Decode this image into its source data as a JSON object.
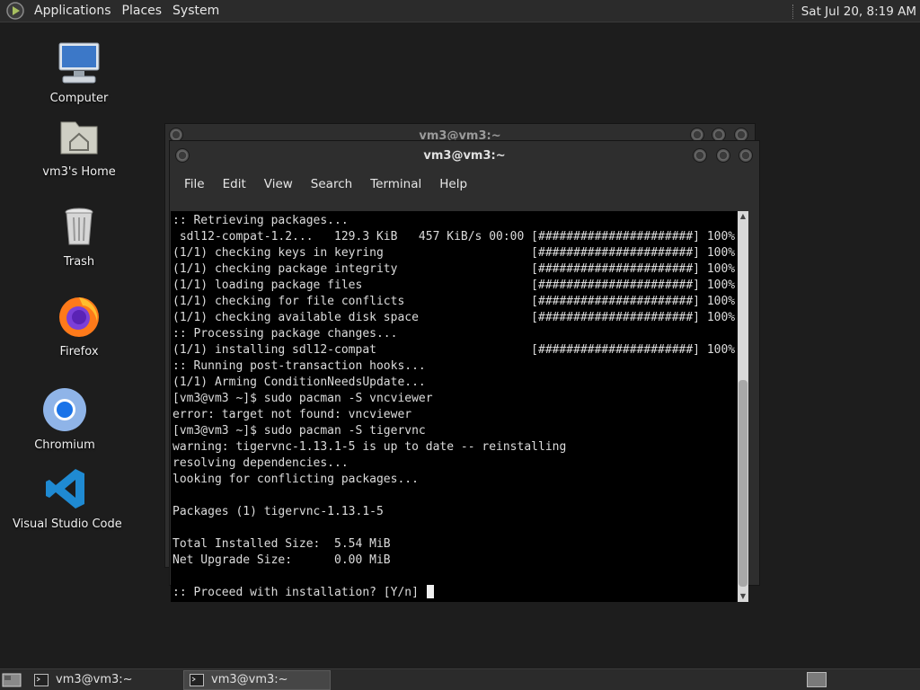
{
  "top_panel": {
    "menus": [
      "Applications",
      "Places",
      "System"
    ],
    "clock": "Sat Jul 20,  8:19 AM"
  },
  "desktop_icons": [
    {
      "label": "Computer",
      "icon": "computer-icon"
    },
    {
      "label": "vm3's Home",
      "icon": "home-folder-icon"
    },
    {
      "label": "Trash",
      "icon": "trash-icon"
    },
    {
      "label": "Firefox",
      "icon": "firefox-icon"
    },
    {
      "label": "Chromium",
      "icon": "chromium-icon"
    },
    {
      "label": "Visual Studio Code",
      "icon": "vscode-icon"
    }
  ],
  "back_window": {
    "title": "vm3@vm3:~"
  },
  "terminal": {
    "title": "vm3@vm3:~",
    "menus": [
      "File",
      "Edit",
      "View",
      "Search",
      "Terminal",
      "Help"
    ],
    "lines": [
      ":: Retrieving packages...",
      " sdl12-compat-1.2...   129.3 KiB   457 KiB/s 00:00 [######################] 100%",
      "(1/1) checking keys in keyring                     [######################] 100%",
      "(1/1) checking package integrity                   [######################] 100%",
      "(1/1) loading package files                        [######################] 100%",
      "(1/1) checking for file conflicts                  [######################] 100%",
      "(1/1) checking available disk space                [######################] 100%",
      ":: Processing package changes...",
      "(1/1) installing sdl12-compat                      [######################] 100%",
      ":: Running post-transaction hooks...",
      "(1/1) Arming ConditionNeedsUpdate...",
      "[vm3@vm3 ~]$ sudo pacman -S vncviewer",
      "error: target not found: vncviewer",
      "[vm3@vm3 ~]$ sudo pacman -S tigervnc",
      "warning: tigervnc-1.13.1-5 is up to date -- reinstalling",
      "resolving dependencies...",
      "looking for conflicting packages...",
      "",
      "Packages (1) tigervnc-1.13.1-5",
      "",
      "Total Installed Size:  5.54 MiB",
      "Net Upgrade Size:      0.00 MiB",
      ""
    ],
    "prompt": ":: Proceed with installation? [Y/n] "
  },
  "taskbar": {
    "tasks": [
      {
        "label": "vm3@vm3:~",
        "active": false
      },
      {
        "label": "vm3@vm3:~",
        "active": true
      }
    ]
  },
  "colors": {
    "terminal_bg": "#000000",
    "panel_bg": "#2b2b2b",
    "desktop_bg": "#1d1d1d"
  }
}
